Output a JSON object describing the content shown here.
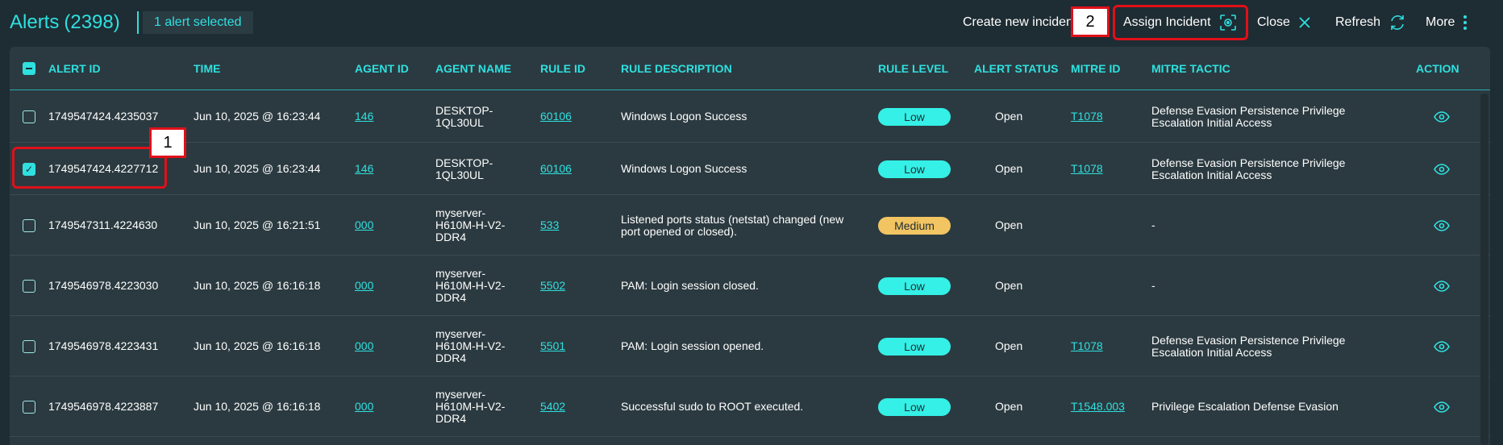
{
  "header": {
    "title": "Alerts",
    "count": "(2398)",
    "selected_text": "1 alert selected",
    "create_label": "Create new inciden",
    "assign_label": "Assign Incident",
    "close_label": "Close",
    "refresh_label": "Refresh",
    "more_label": "More"
  },
  "markers": {
    "m1": "1",
    "m2": "2"
  },
  "columns": {
    "alert_id": "ALERT ID",
    "time": "TIME",
    "agent_id": "AGENT ID",
    "agent_name": "AGENT NAME",
    "rule_id": "RULE ID",
    "rule_description": "RULE DESCRIPTION",
    "rule_level": "RULE LEVEL",
    "alert_status": "ALERT STATUS",
    "mitre_id": "MITRE ID",
    "mitre_tactic": "MITRE TACTIC",
    "action": "ACTION"
  },
  "rows": [
    {
      "checked": false,
      "alert_id": "1749547424.4235037",
      "time": "Jun 10, 2025 @ 16:23:44",
      "agent_id": "146",
      "agent_name": "DESKTOP-1QL30UL",
      "rule_id": "60106",
      "rule_description": "Windows Logon Success",
      "rule_level": "Low",
      "alert_status": "Open",
      "mitre_id": "T1078",
      "mitre_tactic": "Defense Evasion Persistence Privilege Escalation Initial Access"
    },
    {
      "checked": true,
      "alert_id": "1749547424.4227712",
      "time": "Jun 10, 2025 @ 16:23:44",
      "agent_id": "146",
      "agent_name": "DESKTOP-1QL30UL",
      "rule_id": "60106",
      "rule_description": "Windows Logon Success",
      "rule_level": "Low",
      "alert_status": "Open",
      "mitre_id": "T1078",
      "mitre_tactic": "Defense Evasion Persistence Privilege Escalation Initial Access"
    },
    {
      "checked": false,
      "alert_id": "1749547311.4224630",
      "time": "Jun 10, 2025 @ 16:21:51",
      "agent_id": "000",
      "agent_name": "myserver-H610M-H-V2-DDR4",
      "rule_id": "533",
      "rule_description": "Listened ports status (netstat) changed (new port opened or closed).",
      "rule_level": "Medium",
      "alert_status": "Open",
      "mitre_id": "",
      "mitre_tactic": "-"
    },
    {
      "checked": false,
      "alert_id": "1749546978.4223030",
      "time": "Jun 10, 2025 @ 16:16:18",
      "agent_id": "000",
      "agent_name": "myserver-H610M-H-V2-DDR4",
      "rule_id": "5502",
      "rule_description": "PAM: Login session closed.",
      "rule_level": "Low",
      "alert_status": "Open",
      "mitre_id": "",
      "mitre_tactic": "-"
    },
    {
      "checked": false,
      "alert_id": "1749546978.4223431",
      "time": "Jun 10, 2025 @ 16:16:18",
      "agent_id": "000",
      "agent_name": "myserver-H610M-H-V2-DDR4",
      "rule_id": "5501",
      "rule_description": "PAM: Login session opened.",
      "rule_level": "Low",
      "alert_status": "Open",
      "mitre_id": "T1078",
      "mitre_tactic": "Defense Evasion Persistence Privilege Escalation Initial Access"
    },
    {
      "checked": false,
      "alert_id": "1749546978.4223887",
      "time": "Jun 10, 2025 @ 16:16:18",
      "agent_id": "000",
      "agent_name": "myserver-H610M-H-V2-DDR4",
      "rule_id": "5402",
      "rule_description": "Successful sudo to ROOT executed.",
      "rule_level": "Low",
      "alert_status": "Open",
      "mitre_id": "T1548.003",
      "mitre_tactic": "Privilege Escalation Defense Evasion"
    }
  ],
  "colors": {
    "accent": "#2fe0e0",
    "low": "#34f0e6",
    "medium": "#f2c462",
    "highlight": "#e0101a"
  }
}
